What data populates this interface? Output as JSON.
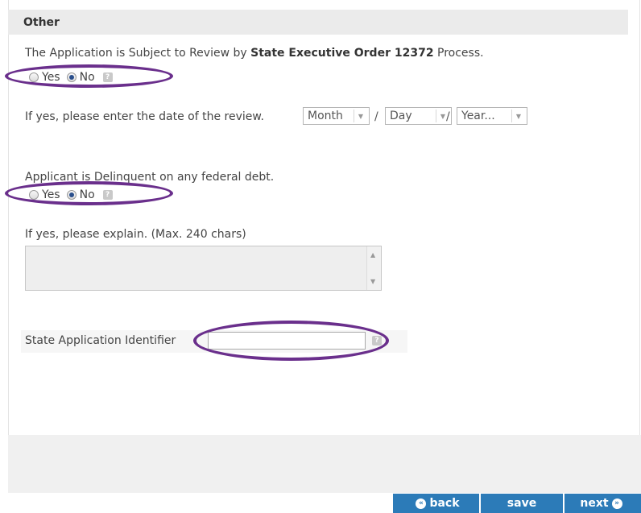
{
  "section": {
    "title": "Other"
  },
  "review": {
    "prompt_prefix": "The Application is Subject to Review by",
    "prompt_bold": "State Executive Order 12372",
    "prompt_suffix": "Process.",
    "yes_label": "Yes",
    "no_label": "No",
    "selected": "No",
    "help_icon_text": "?"
  },
  "review_date": {
    "prompt": "If yes, please enter the date of the review.",
    "month": "Month",
    "day": "Day",
    "year": "Year...",
    "separator": "/"
  },
  "delinquent": {
    "prompt": "Applicant is Delinquent on any federal debt.",
    "yes_label": "Yes",
    "no_label": "No",
    "selected": "No",
    "help_icon_text": "?"
  },
  "explain": {
    "prompt": "If yes, please explain. (Max. 240 chars)",
    "value": ""
  },
  "state_id": {
    "label": "State Application Identifier",
    "value": "",
    "help_icon_text": "?"
  },
  "nav": {
    "back_label": "back",
    "save_label": "save",
    "next_label": "next",
    "back_icon": "«",
    "next_icon": "»"
  },
  "colors": {
    "accent": "#2c7bb8",
    "highlight_ellipse": "#6a2f8c"
  }
}
